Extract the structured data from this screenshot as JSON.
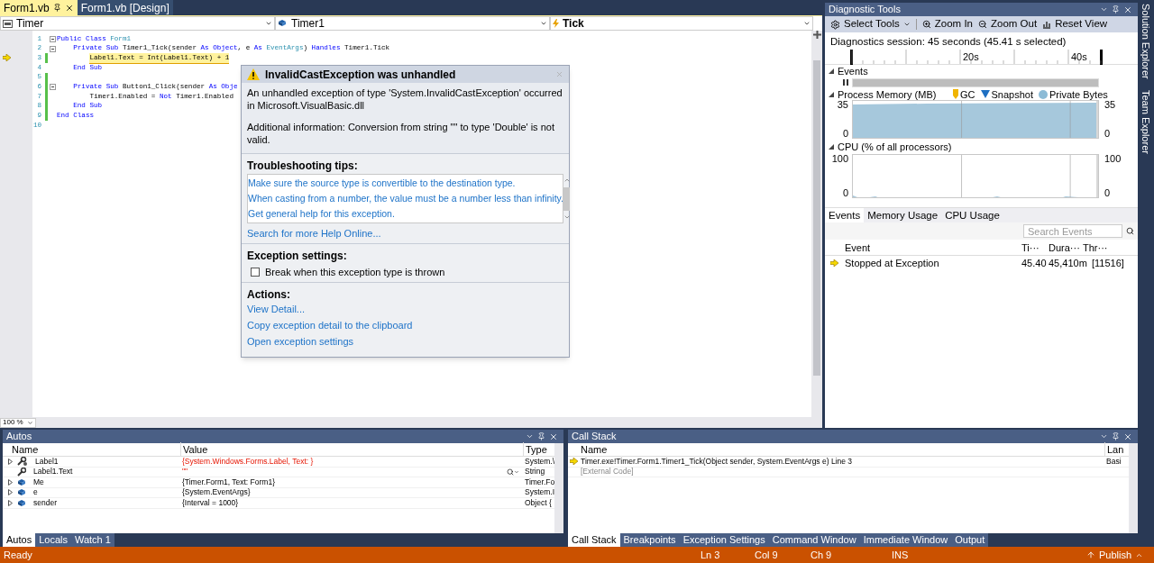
{
  "editor": {
    "tabs": [
      {
        "label": "Form1.vb",
        "selected": true
      },
      {
        "label": "Form1.vb [Design]",
        "selected": false
      }
    ],
    "nav": [
      {
        "label": "Timer",
        "kind": "project"
      },
      {
        "label": "Timer1",
        "kind": "object"
      },
      {
        "label": "Tick",
        "kind": "event"
      }
    ],
    "lines": [
      {
        "number": "1",
        "current": false,
        "changed": false,
        "outline": true,
        "tokens": [
          {
            "text": "Public Class",
            "kind": "kw"
          },
          {
            "text": " Form1",
            "kind": "type"
          }
        ]
      },
      {
        "number": "2",
        "current": false,
        "changed": false,
        "outline": true,
        "tokens": [
          {
            "text": "    Private Sub",
            "kind": "kw"
          },
          {
            "text": " Timer1_Tick(sender ",
            "kind": "plain"
          },
          {
            "text": "As Object",
            "kind": "kw"
          },
          {
            "text": ", e ",
            "kind": "plain"
          },
          {
            "text": "As",
            "kind": "kw"
          },
          {
            "text": " EventArgs",
            "kind": "type"
          },
          {
            "text": ") ",
            "kind": "plain"
          },
          {
            "text": "Handles",
            "kind": "kw"
          },
          {
            "text": " Timer1.Tick",
            "kind": "plain"
          }
        ]
      },
      {
        "number": "3",
        "current": true,
        "changed": true,
        "outline": false,
        "tokens": [
          {
            "text": "Label1.Text = Int(Label1.Text) + 1",
            "kind": "plain"
          }
        ]
      },
      {
        "number": "4",
        "current": false,
        "changed": false,
        "outline": false,
        "tokens": [
          {
            "text": "    End Sub",
            "kind": "kw"
          }
        ]
      },
      {
        "number": "5",
        "current": false,
        "changed": true,
        "outline": false
      },
      {
        "number": "6",
        "current": false,
        "changed": true,
        "outline": true,
        "tokens": [
          {
            "text": "    Private Sub",
            "kind": "kw"
          },
          {
            "text": " Button1_Click(sender ",
            "kind": "plain"
          },
          {
            "text": "As Obje",
            "kind": "kw"
          }
        ]
      },
      {
        "number": "7",
        "current": false,
        "changed": true,
        "outline": false,
        "tokens": [
          {
            "text": "        Timer1.Enabled = ",
            "kind": "plain"
          },
          {
            "text": "Not",
            "kind": "kw"
          },
          {
            "text": " Timer1.Enabled",
            "kind": "plain"
          }
        ]
      },
      {
        "number": "8",
        "current": false,
        "changed": true,
        "outline": false,
        "tokens": [
          {
            "text": "    End Sub",
            "kind": "kw"
          }
        ]
      },
      {
        "number": "9",
        "current": false,
        "changed": true,
        "outline": false,
        "tokens": [
          {
            "text": "End Class",
            "kind": "kw"
          }
        ]
      },
      {
        "number": "10",
        "current": false,
        "changed": false,
        "outline": false
      }
    ],
    "zoom": "100 %"
  },
  "exception": {
    "title": "InvalidCastException was unhandled",
    "message": "An unhandled exception of type 'System.InvalidCastException' occurred in Microsoft.VisualBasic.dll",
    "additional": "Additional information: Conversion from string \"\" to type 'Double' is not valid.",
    "tips_heading": "Troubleshooting tips:",
    "tips": [
      "Make sure the source type is convertible to the destination type.",
      "When casting from a number, the value must be a number less than infinity.",
      "Get general help for this exception."
    ],
    "help_link": "Search for more Help Online...",
    "settings_heading": "Exception settings:",
    "break_option": {
      "label": "Break when this exception type is thrown",
      "checked": false
    },
    "actions_heading": "Actions:",
    "actions": [
      "View Detail...",
      "Copy exception detail to the clipboard",
      "Open exception settings"
    ]
  },
  "diagnostics": {
    "title": "Diagnostic Tools",
    "toolbar": [
      {
        "label": "Select Tools",
        "kind": "select"
      },
      {
        "label": "Zoom In",
        "kind": "zoom_in"
      },
      {
        "label": "Zoom Out",
        "kind": "zoom_out"
      },
      {
        "label": "Reset View",
        "kind": "reset"
      }
    ],
    "session": "Diagnostics session: 45 seconds (45.41 s selected)",
    "ruler_labels": [
      "20s",
      "40s"
    ],
    "events_heading": "Events",
    "memory": {
      "heading": "Process Memory (MB)",
      "legend": [
        {
          "label": "GC",
          "kind": "gc",
          "color": "#f0b400"
        },
        {
          "label": "Snapshot",
          "kind": "snapshot",
          "color": "#1e6fc2"
        },
        {
          "label": "Private Bytes",
          "kind": "bytes",
          "color": "#8cbbd6"
        }
      ],
      "left_ticks": [
        "35",
        "0"
      ],
      "right_ticks": [
        "35",
        "0"
      ],
      "kind": "memory"
    },
    "cpu": {
      "heading": "CPU (% of all processors)",
      "left_ticks": [
        "100",
        "0"
      ],
      "right_ticks": [
        "100",
        "0"
      ],
      "kind": "cpu"
    },
    "tabs": [
      {
        "label": "Events",
        "selected": true
      },
      {
        "label": "Memory Usage",
        "selected": false
      },
      {
        "label": "CPU Usage",
        "selected": false
      }
    ],
    "search_placeholder": "Search Events",
    "columns": [
      "Event",
      "Ti···",
      "Dura···",
      "Thr···"
    ],
    "rows": [
      {
        "event": "Stopped at Exception",
        "time": "45.40",
        "duration": "45,410m",
        "thread": "[11516]"
      }
    ]
  },
  "autos": {
    "title": "Autos",
    "columns": [
      "Name",
      "Value",
      "Type"
    ],
    "rows": [
      {
        "name": "Label1",
        "value": "{System.Windows.Forms.Label, Text: }",
        "type": "System.\\",
        "kind": "property",
        "expandable": true,
        "changed": true
      },
      {
        "name": "Label1.Text",
        "value": "\"\"",
        "type": "String",
        "kind": "property_value",
        "expandable": false,
        "changed": true
      },
      {
        "name": "Me",
        "value": "{Timer.Form1, Text: Form1}",
        "type": "Timer.Fo",
        "kind": "object",
        "expandable": true,
        "changed": false
      },
      {
        "name": "e",
        "value": "{System.EventArgs}",
        "type": "System.I",
        "kind": "object",
        "expandable": true,
        "changed": false
      },
      {
        "name": "sender",
        "value": "{Interval = 1000}",
        "type": "Object {",
        "kind": "object",
        "expandable": true,
        "changed": false
      }
    ],
    "tabs": [
      {
        "label": "Autos",
        "selected": true
      },
      {
        "label": "Locals",
        "selected": false
      },
      {
        "label": "Watch 1",
        "selected": false
      }
    ]
  },
  "call_stack": {
    "title": "Call Stack",
    "columns": [
      "Name",
      "Lan"
    ],
    "rows": [
      {
        "name": "Timer.exe!Timer.Form1.Timer1_Tick(Object sender, System.EventArgs e) Line 3",
        "language": "Basi",
        "current": true,
        "kind": "frame"
      },
      {
        "name": "[External Code]",
        "current": false,
        "kind": "external"
      }
    ],
    "tabs": [
      {
        "label": "Call Stack",
        "selected": true
      },
      {
        "label": "Breakpoints",
        "selected": false
      },
      {
        "label": "Exception Settings",
        "selected": false
      },
      {
        "label": "Command Window",
        "selected": false
      },
      {
        "label": "Immediate Window",
        "selected": false
      },
      {
        "label": "Output",
        "selected": false
      }
    ]
  },
  "side_tabs": [
    "Solution Explorer",
    "Team Explorer"
  ],
  "status_bar": {
    "message": "Ready",
    "position": [
      {
        "label": "Ln 3"
      },
      {
        "label": "Col 9"
      },
      {
        "label": "Ch 9"
      },
      {
        "label": "INS"
      }
    ],
    "publish": "Publish"
  }
}
